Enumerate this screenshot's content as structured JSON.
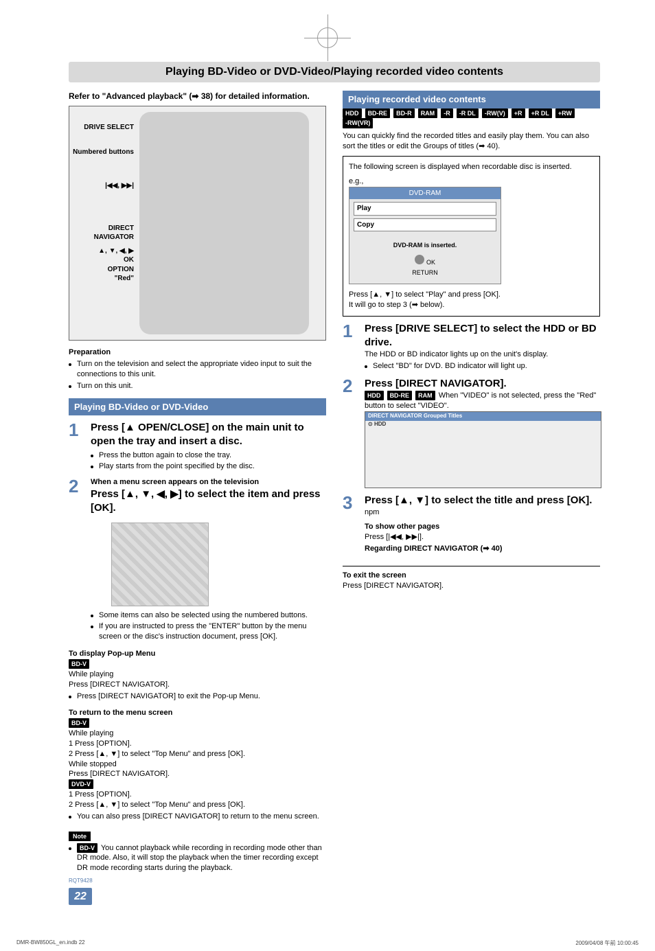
{
  "page_title": "Playing BD-Video or DVD-Video/Playing recorded video contents",
  "refer_text": "Refer to \"Advanced playback\" (➡ 38) for detailed information.",
  "remote_labels": {
    "drive_select": "DRIVE SELECT",
    "numbered": "Numbered buttons",
    "prev_next": "|◀◀, ▶▶|",
    "direct_nav": "DIRECT NAVIGATOR",
    "arrows": "▲, ▼, ◀, ▶",
    "ok": "OK",
    "option": "OPTION",
    "red": "\"Red\""
  },
  "preparation_title": "Preparation",
  "preparation_bullets": [
    "Turn on the television and select the appropriate video input to suit the connections to this unit.",
    "Turn on this unit."
  ],
  "left": {
    "section_title": "Playing BD-Video or DVD-Video",
    "step1_head": "Press [▲ OPEN/CLOSE] on the main unit to open the tray and insert a disc.",
    "step1_b1": "Press the button again to close the tray.",
    "step1_b2": "Play starts from the point specified by the disc.",
    "step2_pre": "When a menu screen appears on the television",
    "step2_head": "Press [▲, ▼, ◀, ▶] to select the item and press [OK].",
    "step2_b1": "Some items can also be selected using the numbered buttons.",
    "step2_b2": "If you are instructed to press the \"ENTER\" button by the menu screen or the disc's instruction document, press [OK].",
    "popup_title": "To display Pop-up Menu",
    "bdv_tag": "BD-V",
    "popup_l1": "While playing",
    "popup_l2": "Press [DIRECT NAVIGATOR].",
    "popup_b1": "Press [DIRECT NAVIGATOR] to exit the Pop-up Menu.",
    "return_title": "To return to the menu screen",
    "return_l1": "While playing",
    "return_l2": "1   Press [OPTION].",
    "return_l3": "2   Press [▲, ▼] to select \"Top Menu\" and press [OK].",
    "return_l4": "While stopped",
    "return_l5": "Press [DIRECT NAVIGATOR].",
    "dvdv_tag": "DVD-V",
    "return_l6": "1   Press [OPTION].",
    "return_l7": "2   Press [▲, ▼] to select \"Top Menu\" and press [OK].",
    "return_b1": "You can also press [DIRECT NAVIGATOR] to return to the menu screen.",
    "note_label": "Note",
    "note_text": " You cannot playback while recording in recording mode other than DR mode. Also, it will stop the playback when the timer recording except DR mode recording starts during the playback."
  },
  "right": {
    "section_title": "Playing recorded video contents",
    "disc_tags": [
      "HDD",
      "BD-RE",
      "BD-R",
      "RAM",
      "-R",
      "-R DL",
      "-RW(V)",
      "+R",
      "+R DL",
      "+RW",
      "-RW(VR)"
    ],
    "intro": "You can quickly find the recorded titles and easily play them. You can also sort the titles or edit the Groups of titles (➡ 40).",
    "box_line": "The following screen is displayed when recordable disc is inserted.",
    "eg": "e.g.,",
    "dvdram_title": "DVD-RAM",
    "dvdram_play": "Play",
    "dvdram_copy": "Copy",
    "dvdram_msg": "DVD-RAM is inserted.",
    "box_press": "Press [▲, ▼] to select \"Play\" and press [OK].",
    "box_goto": "It will go to step 3 (➡ below).",
    "step1_head": "Press [DRIVE SELECT] to select the HDD or BD drive.",
    "step1_sub": "The HDD or BD indicator lights up on the unit's display.",
    "step1_b1": "Select \"BD\" for DVD. BD indicator will light up.",
    "step2_head": "Press [DIRECT NAVIGATOR].",
    "step2_tags": [
      "HDD",
      "BD-RE",
      "RAM"
    ],
    "step2_sub": " When \"VIDEO\" is not selected, press the \"Red\" button to select \"VIDEO\".",
    "nav_header": "DIRECT NAVIGATOR  Grouped Titles",
    "nav_hdd": "HDD",
    "step3_head": "Press [▲, ▼] to select the title and press [OK].",
    "step3_show": "To show other pages",
    "step3_press": "Press [|◀◀, ▶▶|].",
    "step3_reg": "Regarding DIRECT NAVIGATOR (➡ 40)",
    "exit_title": "To exit the screen",
    "exit_line": "Press [DIRECT NAVIGATOR]."
  },
  "rqt": "RQT9428",
  "page_number": "22",
  "footer_left": "DMR-BW850GL_en.indb   22",
  "footer_right": "2009/04/08   午前 10:00:45"
}
